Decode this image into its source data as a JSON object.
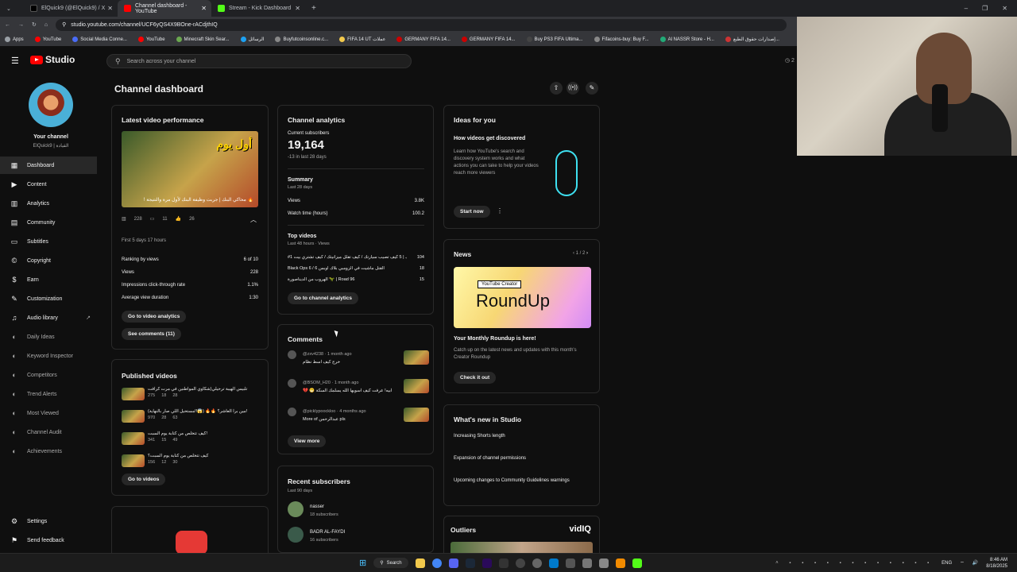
{
  "tabs": [
    {
      "title": "ElQuick9 (@ElQuick9) / X",
      "color": "#000"
    },
    {
      "title": "Channel dashboard - YouTube",
      "color": "#ff0000"
    },
    {
      "title": "Stream - Kick Dashboard",
      "color": "#53fc18"
    }
  ],
  "url": "studio.youtube.com/channel/UCF6yQS4X9BOne-rACdjthIQ",
  "bookmarks": [
    "Apps",
    "YouTube",
    "Social Media Conne...",
    "YouTube",
    "Minecraft Skin Sear...",
    "الرسائل",
    "Buyfutcoinsonline.c...",
    "FIFA 14 UT عملات",
    "GERMANY FIFA 14...",
    "GERMANY FIFA 14...",
    "Buy PS3 FIFA Ultima...",
    "Fifacoins-buy: Buy F...",
    "Al NASSR Store - H...",
    "إصدارات حقوق الطبع..."
  ],
  "header": {
    "studio": "Studio",
    "search_placeholder": "Search across your channel"
  },
  "channel": {
    "title": "Your channel",
    "handle": "ElQuick9 | القيادة"
  },
  "nav": [
    "Dashboard",
    "Content",
    "Analytics",
    "Community",
    "Subtitles",
    "Copyright",
    "Earn",
    "Customization",
    "Audio library",
    "Daily Ideas",
    "Keyword Inspector",
    "Competitors",
    "Trend Alerts",
    "Most Viewed",
    "Channel Audit",
    "Achievements"
  ],
  "nav_bottom": [
    "Settings",
    "Send feedback"
  ],
  "page_title": "Channel dashboard",
  "latest": {
    "title": "Latest video performance",
    "caption": "! محاكي البنك | جربت وظيفة البنك لأول مرة والنتيجة 🔥",
    "views": "228",
    "comments": "11",
    "likes": "26",
    "first": "First 5 days 17 hours",
    "rows": [
      [
        "Ranking by views",
        "6 of 10"
      ],
      [
        "Views",
        "228"
      ],
      [
        "Impressions click-through rate",
        "1.1%"
      ],
      [
        "Average view duration",
        "1:30"
      ]
    ],
    "btn1": "Go to video analytics",
    "btn2": "See comments (11)"
  },
  "published": {
    "title": "Published videos",
    "items": [
      {
        "t": "تلبيس الهيبة ترحيلي(شكاوي المواطنين في مرت كرافت",
        "v": "275",
        "c": "18",
        "l": "28"
      },
      {
        "t": "(مستحيل اللي صار بالنهاية!!😱) 🔥🔥 مين برا العاشر؟!",
        "v": "970",
        "c": "28",
        "l": "63"
      },
      {
        "t": "كيف تتخلص من كتابة يوم السبت!",
        "v": "341",
        "c": "15",
        "l": "49"
      },
      {
        "t": "كيف تتخلص من كتابة يوم السبت؟",
        "v": "156",
        "c": "12",
        "l": "30"
      }
    ],
    "btn": "Go to videos"
  },
  "analytics": {
    "title": "Channel analytics",
    "subs_label": "Current subscribers",
    "subs": "19,164",
    "subs_change": "-13 in last 28 days",
    "summary": "Summary",
    "summary_sub": "Last 28 days",
    "rows": [
      [
        "Views",
        "3.8K"
      ],
      [
        "Watch time (hours)",
        "100.2"
      ]
    ],
    "top": "Top videos",
    "top_sub": "Last 48 hours · Views",
    "top_items": [
      [
        "#1 فرانك | 5 كيف تصيب سيارتك / كيف تقلل ميزانيتك / كيف تشتري بيت",
        "104"
      ],
      [
        "Black Ops 6 / القتل ماشيت في الزومبي بلاك اوبس 6",
        "18"
      ],
      [
        "الهروب من الديناصورة 🦖 | Road 96",
        "15"
      ]
    ],
    "btn": "Go to channel analytics"
  },
  "comments": {
    "title": "Comments",
    "items": [
      {
        "u": "@zxv4238",
        "t": "1 month ago",
        "c": "خرج كيف اسط نظام"
      },
      {
        "u": "@BSOM_H20",
        "t": "1 month ago",
        "c": "💔 😁 ابيه! عرفت كيف اسويها الله يسلمك السكة"
      },
      {
        "u": "@picklypoockloo",
        "t": "4 months ago",
        "c": "More of عبدالرحمن pls"
      }
    ],
    "btn": "View more"
  },
  "subscribers": {
    "title": "Recent subscribers",
    "sub": "Last 90 days",
    "items": [
      {
        "n": "nasser",
        "s": "18 subscribers"
      },
      {
        "n": "BADR AL-FAYDI",
        "s": "16 subscribers"
      }
    ]
  },
  "ideas": {
    "title": "Ideas for you",
    "head": "How videos get discovered",
    "body": "Learn how YouTube's search and discovery system works and what actions you can take to help your videos reach more viewers",
    "btn": "Start now"
  },
  "news": {
    "title": "News",
    "pager": "1 / 2",
    "banner_tag": "YouTube Creator",
    "banner": "RoundUp",
    "head": "Your Monthly Roundup is here!",
    "body": "Catch up on the latest news and updates with this month's Creator Roundup",
    "btn": "Check it out"
  },
  "whatsnew": {
    "title": "What's new in Studio",
    "items": [
      "Increasing Shorts length",
      "Expansion of channel permissions",
      "Upcoming changes to Community Guidelines warnings"
    ]
  },
  "outliers": {
    "title": "Outliers",
    "brand": "vidIQ"
  },
  "taskbar": {
    "search": "Search",
    "lang": "ENG",
    "time": "8:46 AM",
    "date": "8/18/2025"
  }
}
